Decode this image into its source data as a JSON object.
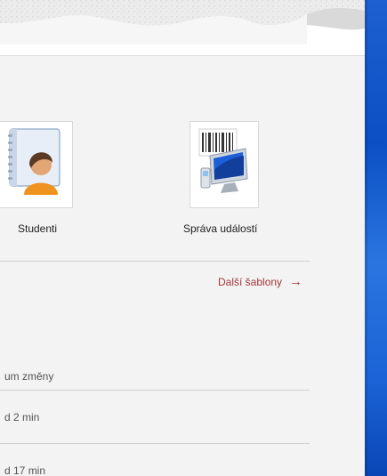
{
  "templates": [
    {
      "label": "Studenti",
      "icon": "student-contact-icon"
    },
    {
      "label": "Správa událostí",
      "icon": "event-management-icon"
    }
  ],
  "more_templates": {
    "label": "Další šablony",
    "icon": "arrow-right-icon"
  },
  "recent": {
    "column_header": "um změny",
    "rows": [
      {
        "modified": "d 2 min"
      },
      {
        "modified": "d 17 min"
      }
    ]
  },
  "colors": {
    "accent": "#a4373a",
    "panel_bg": "#f3f3f3",
    "desktop_blue": "#1e60d0"
  }
}
